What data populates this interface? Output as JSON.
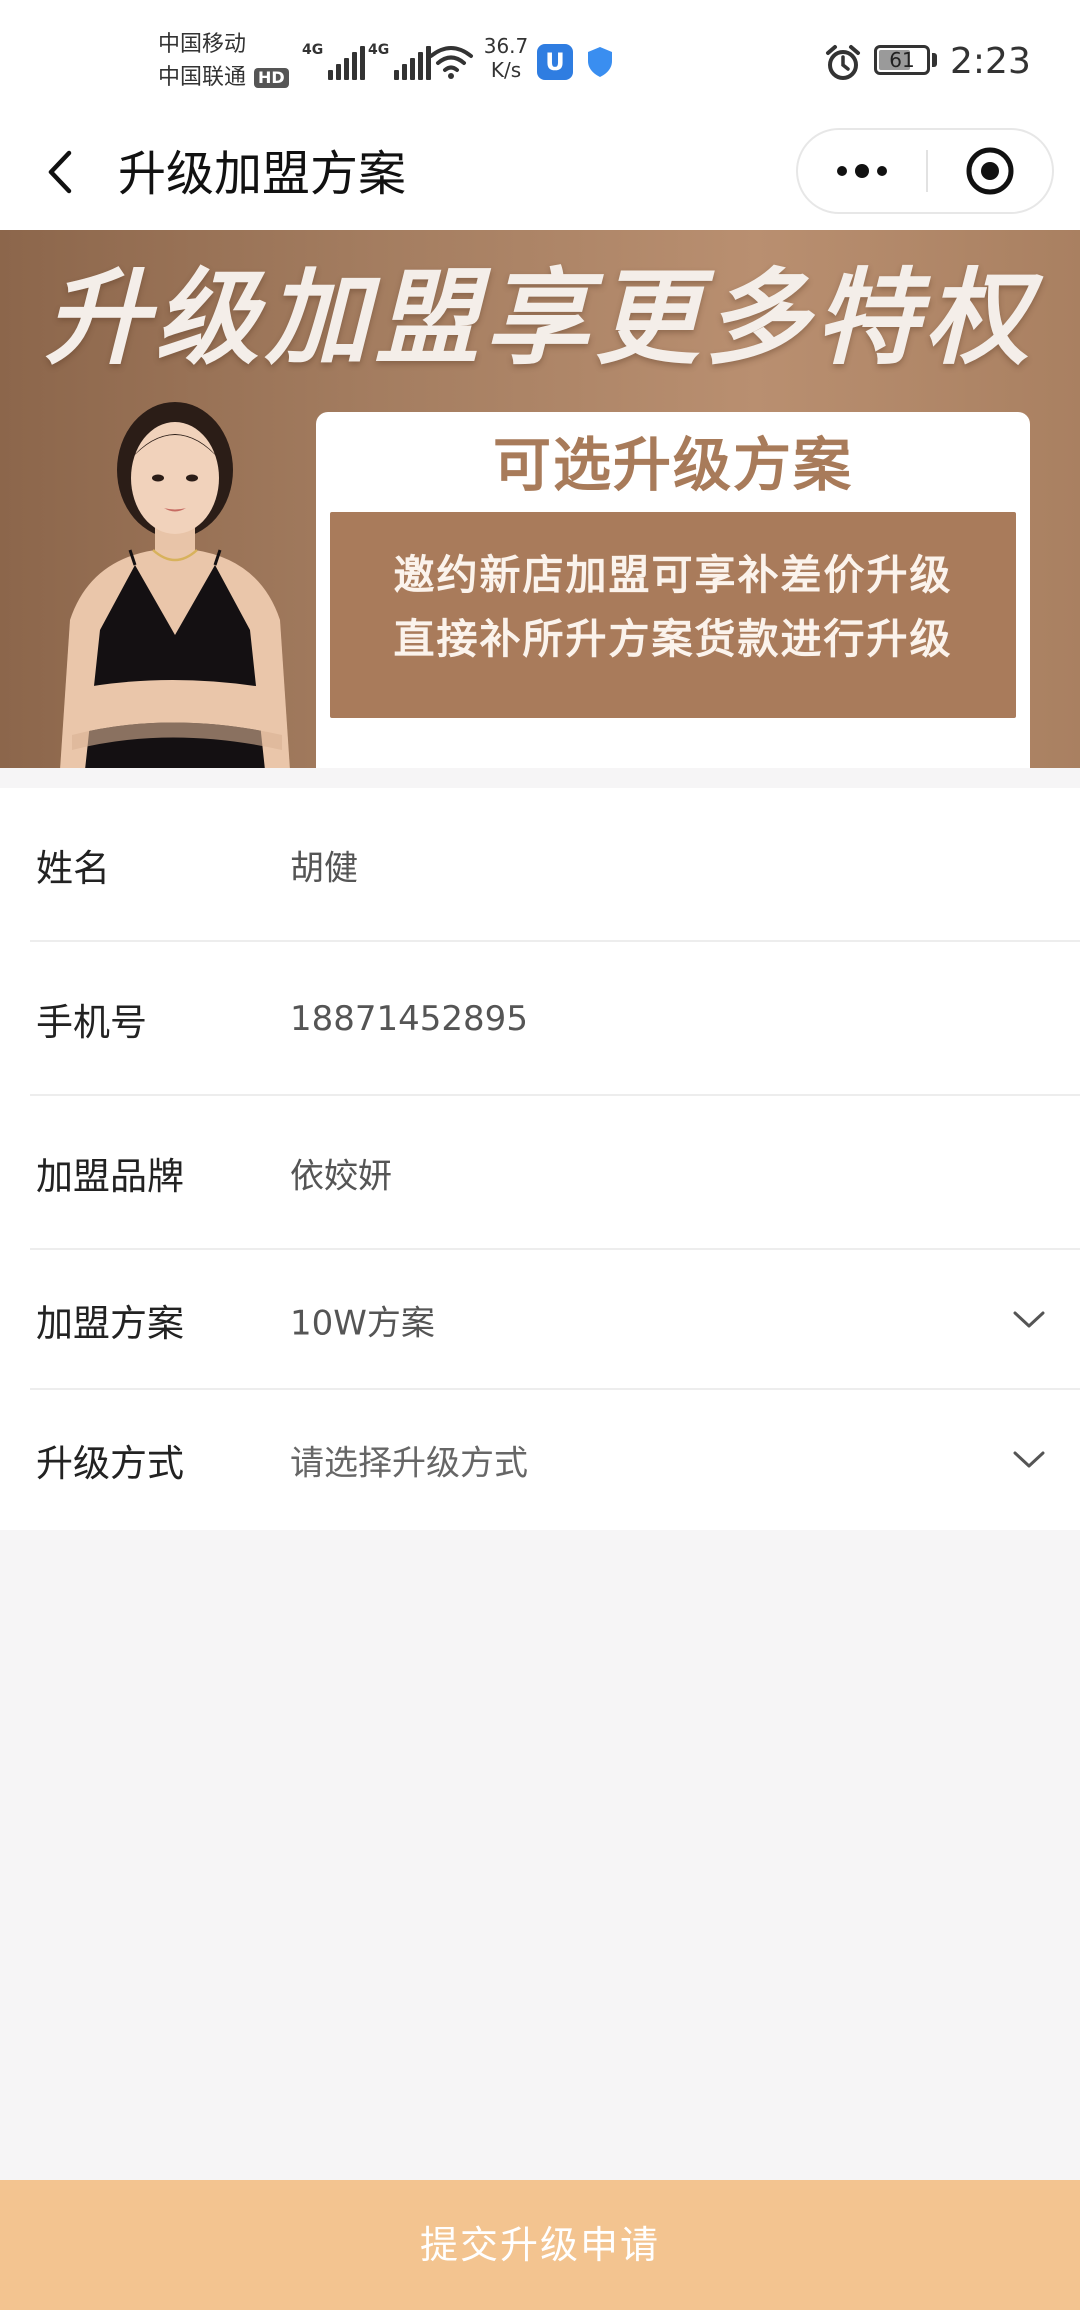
{
  "status_bar": {
    "carrier_1": "中国移动",
    "carrier_2": "中国联通",
    "hd_badge": "HD",
    "network_1": "4G",
    "network_2": "4G",
    "speed_value": "36.7",
    "speed_unit": "K/s",
    "app_icon_letter": "U",
    "battery_level": "61",
    "time": "2:23"
  },
  "nav": {
    "title": "升级加盟方案"
  },
  "banner": {
    "headline": "升级加盟享更多特权",
    "card_title": "可选升级方案",
    "card_line_1": "邀约新店加盟可享补差价升级",
    "card_line_2": "直接补所升方案货款进行升级"
  },
  "form": {
    "name_label": "姓名",
    "name_value": "胡健",
    "phone_label": "手机号",
    "phone_value": "18871452895",
    "brand_label": "加盟品牌",
    "brand_value": "依姣妍",
    "plan_label": "加盟方案",
    "plan_value": "10W方案",
    "upgrade_label": "升级方式",
    "upgrade_placeholder": "请选择升级方式"
  },
  "submit": {
    "label": "提交升级申请"
  },
  "colors": {
    "accent": "#f3c490",
    "banner_brown": "#a97b5b",
    "page_bg": "#f6f5f6"
  },
  "icons": [
    "back-arrow-icon",
    "more-dots-icon",
    "close-target-icon",
    "chevron-down-icon",
    "alarm-icon",
    "shield-icon",
    "wifi-icon",
    "signal-icon",
    "battery-icon"
  ]
}
